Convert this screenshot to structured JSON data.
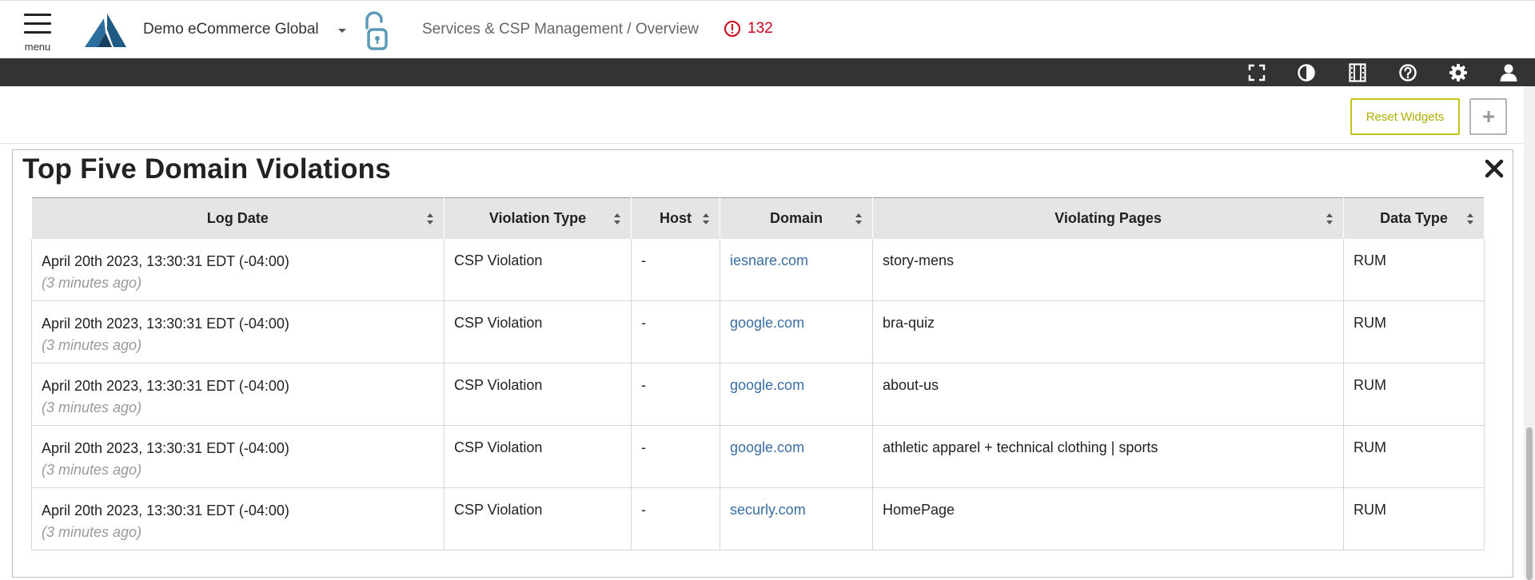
{
  "header": {
    "menu_label": "menu",
    "org_name": "Demo eCommerce Global",
    "breadcrumb": "Services & CSP Management / Overview",
    "alert_count": "132",
    "alert_color": "#d0021b",
    "brand_color": "#1f5a85",
    "lock_color": "#5b9bb8"
  },
  "toolbar": {
    "icons": [
      "fullscreen-icon",
      "contrast-icon",
      "film-icon",
      "help-icon",
      "gear-icon",
      "user-icon"
    ]
  },
  "actions": {
    "reset_label": "Reset Widgets",
    "add_icon": "plus-icon",
    "reset_color": "#c5c31a"
  },
  "widget": {
    "title": "Top Five Domain Violations",
    "columns": [
      "Log Date",
      "Violation Type",
      "Host",
      "Domain",
      "Violating Pages",
      "Data Type"
    ],
    "rows": [
      {
        "date": "April 20th 2023, 13:30:31 EDT (-04:00)",
        "relative": "(3 minutes ago)",
        "type": "CSP Violation",
        "host": "-",
        "domain": "iesnare.com",
        "page": "story-mens",
        "data_type": "RUM"
      },
      {
        "date": "April 20th 2023, 13:30:31 EDT (-04:00)",
        "relative": "(3 minutes ago)",
        "type": "CSP Violation",
        "host": "-",
        "domain": "google.com",
        "page": "bra-quiz",
        "data_type": "RUM"
      },
      {
        "date": "April 20th 2023, 13:30:31 EDT (-04:00)",
        "relative": "(3 minutes ago)",
        "type": "CSP Violation",
        "host": "-",
        "domain": "google.com",
        "page": "about-us",
        "data_type": "RUM"
      },
      {
        "date": "April 20th 2023, 13:30:31 EDT (-04:00)",
        "relative": "(3 minutes ago)",
        "type": "CSP Violation",
        "host": "-",
        "domain": "google.com",
        "page": "athletic apparel + technical clothing | sports",
        "data_type": "RUM"
      },
      {
        "date": "April 20th 2023, 13:30:31 EDT (-04:00)",
        "relative": "(3 minutes ago)",
        "type": "CSP Violation",
        "host": "-",
        "domain": "securly.com",
        "page": "HomePage",
        "data_type": "RUM"
      }
    ],
    "link_color": "#3a6ea5"
  }
}
